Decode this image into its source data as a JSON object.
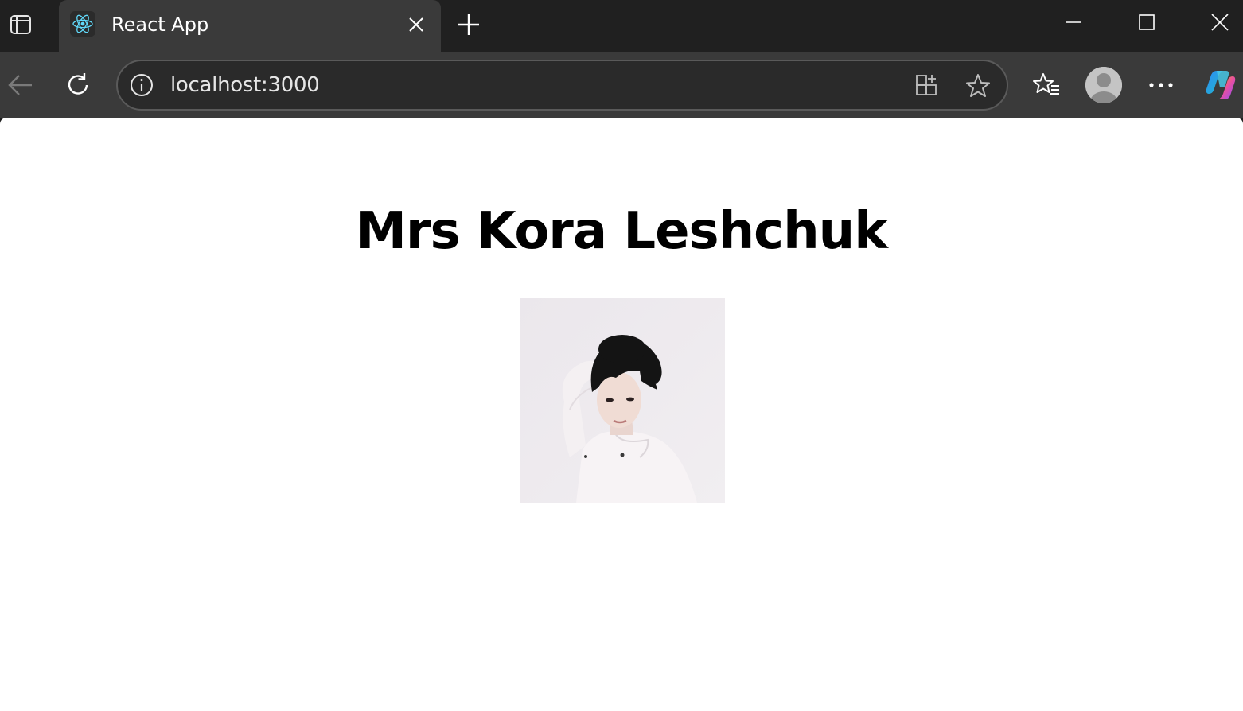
{
  "browser": {
    "tab": {
      "title": "React App",
      "favicon": "react-logo-icon"
    },
    "address_bar": {
      "url": "localhost:3000"
    },
    "icons": {
      "sidebar": "tab-actions-icon",
      "close_tab": "close-icon",
      "new_tab": "plus-icon",
      "minimize": "minimize-icon",
      "maximize": "maximize-icon",
      "close_window": "close-icon",
      "back": "back-arrow-icon",
      "refresh": "refresh-icon",
      "site_info": "info-icon",
      "apps": "apps-icon",
      "favorite": "star-icon",
      "favorites": "favorites-icon",
      "profile": "profile-avatar",
      "more": "more-icon",
      "copilot": "copilot-icon"
    },
    "colors": {
      "chrome_dark": "#202020",
      "toolbar": "#3a3a3a",
      "react_blue": "#61dafb"
    }
  },
  "page": {
    "heading": "Mrs Kora Leshchuk",
    "photo": {
      "description_icon": "profile-photo"
    }
  }
}
